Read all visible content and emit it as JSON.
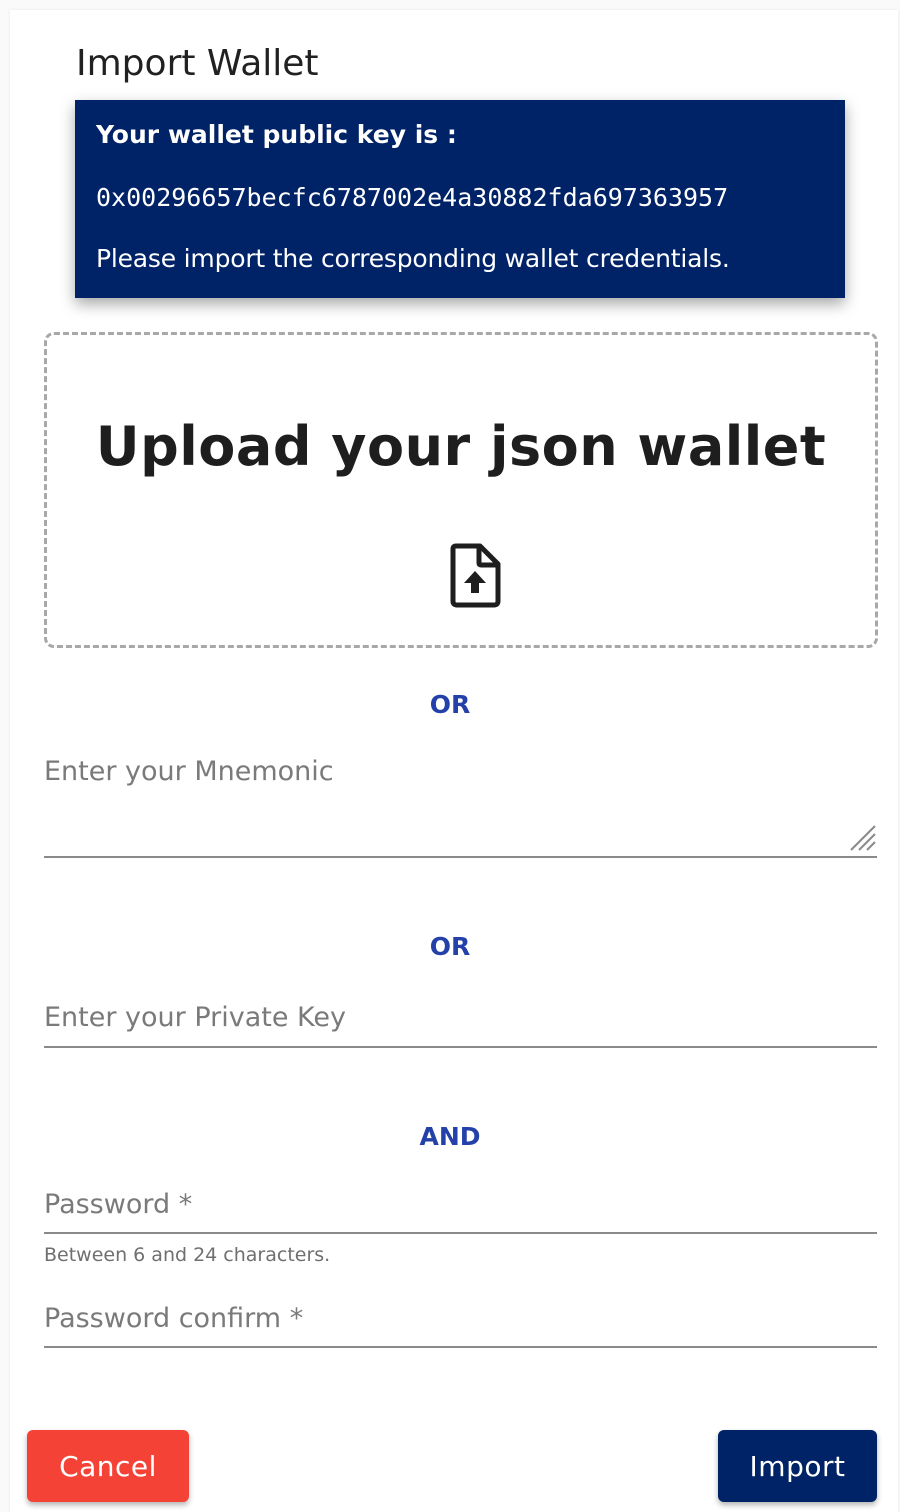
{
  "dialog": {
    "title": "Import Wallet"
  },
  "info": {
    "heading": "Your wallet public key is :",
    "public_key": "0x00296657becfc6787002e4a30882fda697363957",
    "note": "Please import the corresponding wallet credentials."
  },
  "upload": {
    "title": "Upload your json wallet",
    "icon": "file-upload-icon"
  },
  "separators": {
    "or_1": "OR",
    "or_2": "OR",
    "and": "AND"
  },
  "fields": {
    "mnemonic_placeholder": "Enter your Mnemonic",
    "private_key_placeholder": "Enter your Private Key",
    "password_placeholder": "Password *",
    "password_hint": "Between 6 and 24 characters.",
    "password_confirm_placeholder": "Password confirm *"
  },
  "actions": {
    "cancel_label": "Cancel",
    "import_label": "Import"
  },
  "colors": {
    "primary": "#002266",
    "accent_text": "#2341a8",
    "warn": "#f44336"
  }
}
